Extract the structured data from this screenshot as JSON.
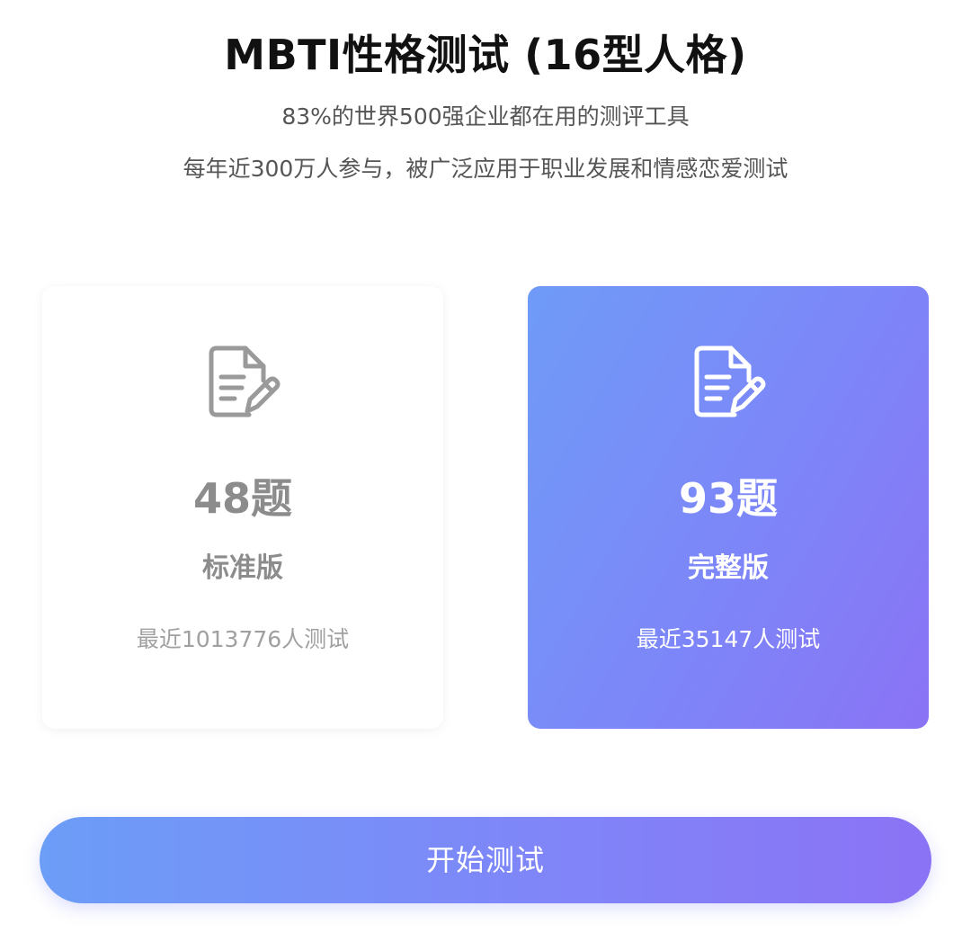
{
  "header": {
    "title": "MBTI性格测试 (16型人格)",
    "subtitle_1": "83%的世界500强企业都在用的测评工具",
    "subtitle_2": "每年近300万人参与，被广泛应用于职业发展和情感恋爱测试"
  },
  "options": [
    {
      "icon": "document-edit-icon",
      "count": "48题",
      "name": "标准版",
      "meta": "最近1013776人测试",
      "selected": false
    },
    {
      "icon": "document-edit-icon",
      "count": "93题",
      "name": "完整版",
      "meta": "最近35147人测试",
      "selected": true
    }
  ],
  "colors": {
    "accent_start": "#6f9bf7",
    "accent_end": "#8a73f5",
    "muted_text": "#8c8c8c"
  },
  "start_button": {
    "label": "开始测试"
  }
}
